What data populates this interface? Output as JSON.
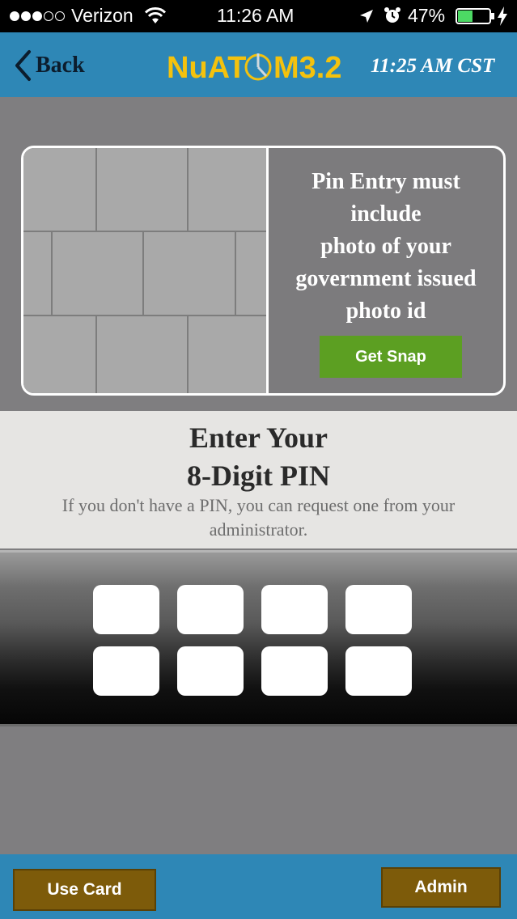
{
  "status_bar": {
    "carrier": "Verizon",
    "time": "11:26 AM",
    "battery_percent": "47%",
    "signal_bars_filled": 3,
    "signal_bars_total": 5,
    "battery_level": 0.47
  },
  "header": {
    "back_label": "Back",
    "logo_text_left": "NuAT",
    "logo_text_right": "M3.2",
    "time": "11:25 AM CST"
  },
  "photo_card": {
    "message_lines": [
      "Pin Entry must",
      "include",
      "photo of your",
      "government issued",
      "photo id"
    ],
    "get_snap_label": "Get Snap"
  },
  "pin": {
    "title_line1": "Enter Your",
    "title_line2": "8-Digit PIN",
    "help_text": "If you don't have a PIN, you can request one from your administrator.",
    "digits": [
      "",
      "",
      "",
      "",
      "",
      "",
      "",
      ""
    ]
  },
  "footer": {
    "use_card_label": "Use Card",
    "admin_label": "Admin"
  },
  "colors": {
    "header_blue": "#2e87b6",
    "logo_yellow": "#f4c20d",
    "snap_green": "#5c9f22",
    "footer_button_brown": "#7d5b0a",
    "page_gray": "#7f7e80"
  }
}
